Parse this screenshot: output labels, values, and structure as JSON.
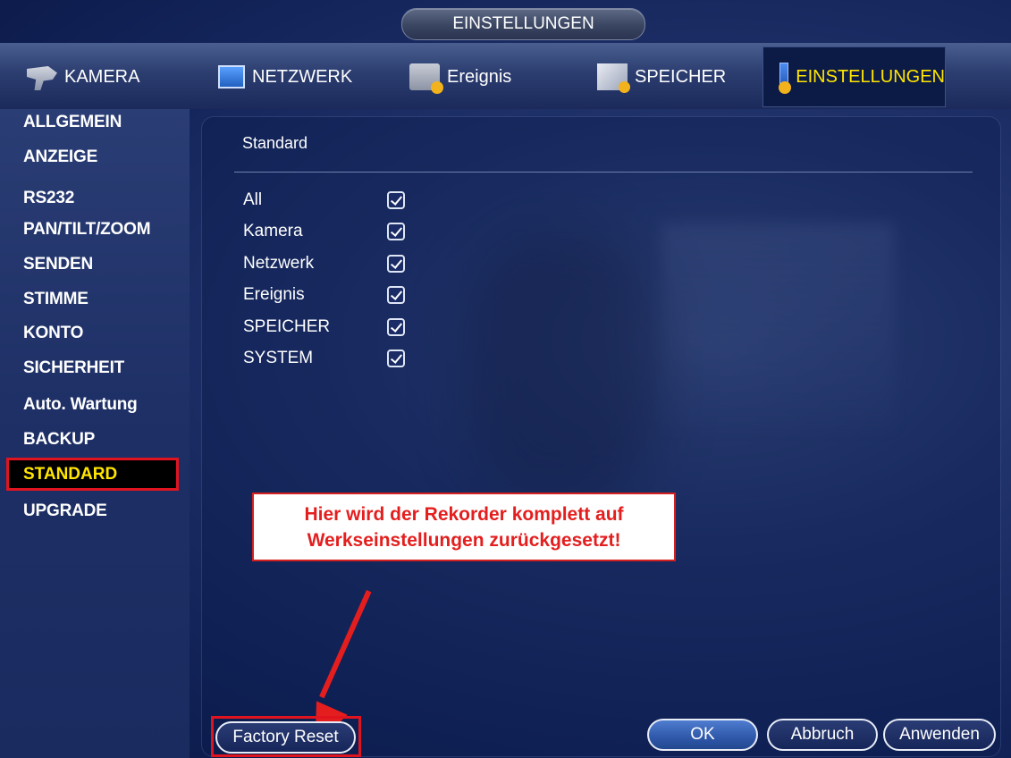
{
  "window": {
    "title": "EINSTELLUNGEN"
  },
  "tabs": [
    {
      "label": "KAMERA",
      "icon": "camera-icon"
    },
    {
      "label": "NETZWERK",
      "icon": "network-icon"
    },
    {
      "label": "Ereignis",
      "icon": "event-icon"
    },
    {
      "label": "SPEICHER",
      "icon": "storage-icon"
    },
    {
      "label": "EINSTELLUNGEN",
      "icon": "settings-icon",
      "active": true
    }
  ],
  "sidebar": {
    "items": [
      {
        "label": "ALLGEMEIN"
      },
      {
        "label": "ANZEIGE"
      },
      {
        "label": "RS232"
      },
      {
        "label": "PAN/TILT/ZOOM"
      },
      {
        "label": "SENDEN"
      },
      {
        "label": "STIMME"
      },
      {
        "label": "KONTO"
      },
      {
        "label": "SICHERHEIT"
      },
      {
        "label": "Auto. Wartung"
      },
      {
        "label": "BACKUP"
      },
      {
        "label": "STANDARD",
        "active": true
      },
      {
        "label": "UPGRADE"
      }
    ]
  },
  "main": {
    "section_title": "Standard",
    "options": [
      {
        "label": "All",
        "checked": true
      },
      {
        "label": "Kamera",
        "checked": true
      },
      {
        "label": "Netzwerk",
        "checked": true
      },
      {
        "label": "Ereignis",
        "checked": true
      },
      {
        "label": "SPEICHER",
        "checked": true
      },
      {
        "label": "SYSTEM",
        "checked": true
      }
    ]
  },
  "annotation": {
    "line1": "Hier wird der Rekorder komplett auf",
    "line2": "Werkseinstellungen zurückgesetzt!",
    "color": "#e41e1e"
  },
  "buttons": {
    "factory_reset": "Factory Reset",
    "ok": "OK",
    "cancel": "Abbruch",
    "apply": "Anwenden"
  },
  "colors": {
    "active_text": "#ffe600",
    "highlight": "#e0141e"
  }
}
